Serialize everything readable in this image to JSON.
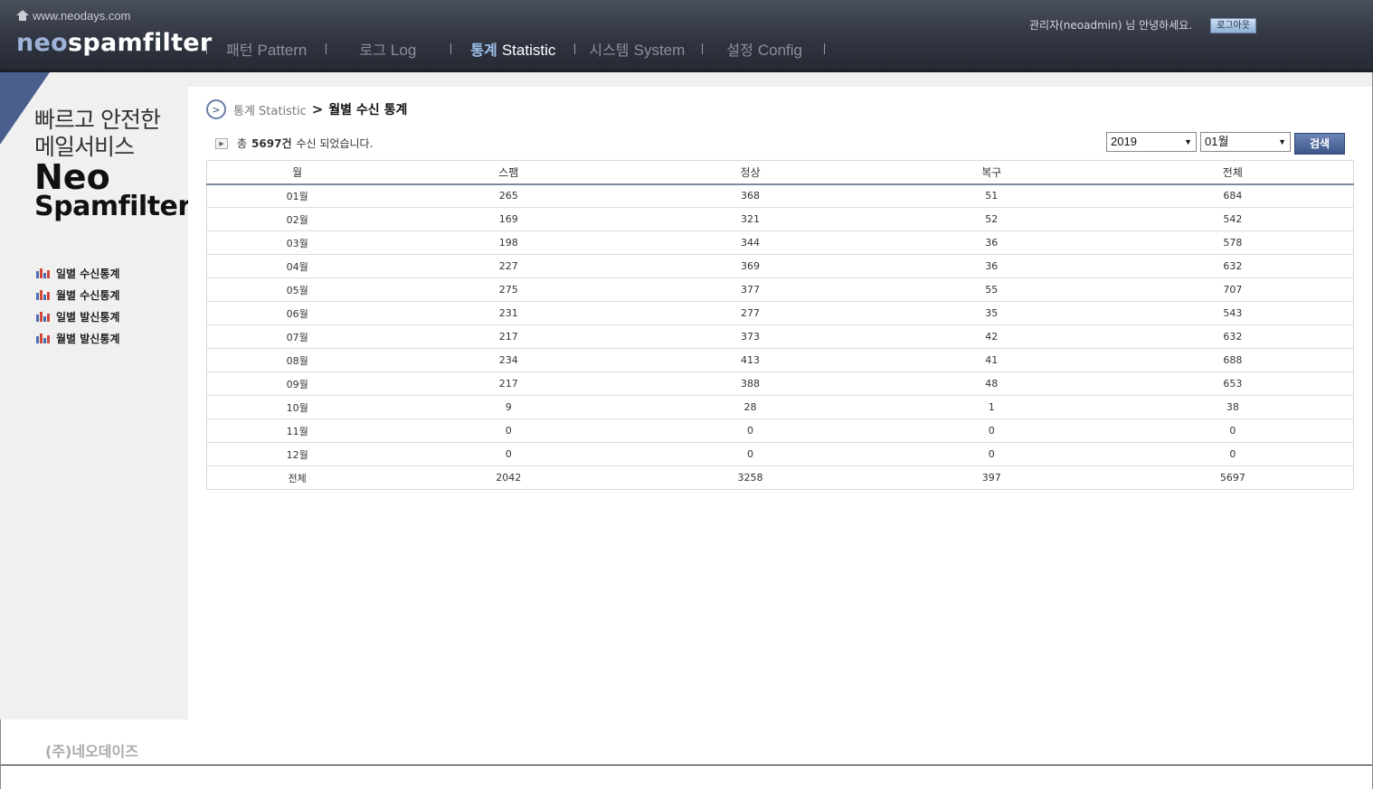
{
  "header": {
    "site_url": "www.neodays.com",
    "logo_prefix": "neo",
    "logo_suffix": "spamfilter",
    "nav": [
      {
        "ko": "패턴",
        "en": "Pattern",
        "active": false
      },
      {
        "ko": "로그",
        "en": "Log",
        "active": false
      },
      {
        "ko": "통계",
        "en": "Statistic",
        "active": true
      },
      {
        "ko": "시스템",
        "en": "System",
        "active": false
      },
      {
        "ko": "설정",
        "en": "Config",
        "active": false
      }
    ],
    "greeting": "관리자(neoadmin) 님 안녕하세요.",
    "logout_label": "로그아웃"
  },
  "sidebar": {
    "slogan_line1": "빠르고 안전한",
    "slogan_line2": "메일서비스",
    "brand_line1": "Neo",
    "brand_line2": "Spamfilter",
    "menu": [
      {
        "label": "일별 수신통계"
      },
      {
        "label": "월별 수신통계"
      },
      {
        "label": "일별 발신통계"
      },
      {
        "label": "월별 발신통계"
      }
    ]
  },
  "breadcrumb": {
    "parent": "통계 Statistic",
    "separator": ">",
    "current": "월별 수신 통계"
  },
  "summary": {
    "prefix": "총",
    "count": "5697건",
    "suffix": "수신 되었습니다."
  },
  "filters": {
    "year": "2019",
    "month": "01월",
    "search_label": "검색"
  },
  "table": {
    "headers": [
      "월",
      "스팸",
      "정상",
      "복구",
      "전체"
    ],
    "rows": [
      [
        "01월",
        "265",
        "368",
        "51",
        "684"
      ],
      [
        "02월",
        "169",
        "321",
        "52",
        "542"
      ],
      [
        "03월",
        "198",
        "344",
        "36",
        "578"
      ],
      [
        "04월",
        "227",
        "369",
        "36",
        "632"
      ],
      [
        "05월",
        "275",
        "377",
        "55",
        "707"
      ],
      [
        "06월",
        "231",
        "277",
        "35",
        "543"
      ],
      [
        "07월",
        "217",
        "373",
        "42",
        "632"
      ],
      [
        "08월",
        "234",
        "413",
        "41",
        "688"
      ],
      [
        "09월",
        "217",
        "388",
        "48",
        "653"
      ],
      [
        "10월",
        "9",
        "28",
        "1",
        "38"
      ],
      [
        "11월",
        "0",
        "0",
        "0",
        "0"
      ],
      [
        "12월",
        "0",
        "0",
        "0",
        "0"
      ],
      [
        "전체",
        "2042",
        "3258",
        "397",
        "5697"
      ]
    ]
  },
  "footer": {
    "company": "(주)네오데이즈"
  },
  "colors": {
    "header_bg": "#2f3440",
    "nav_active": "#9fc2ee",
    "accent": "#4b5f8e",
    "sidebar_bg": "#f0f0f0"
  }
}
